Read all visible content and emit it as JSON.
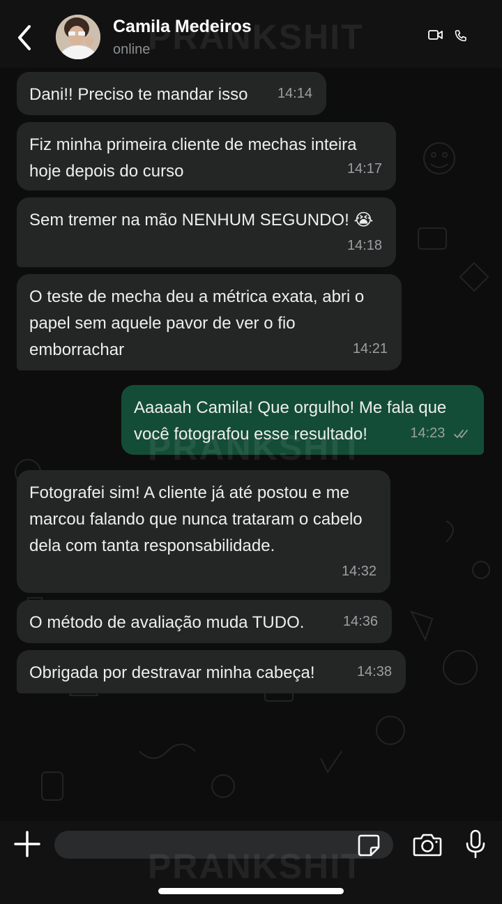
{
  "header": {
    "contact_name": "Camila Medeiros",
    "status": "online",
    "icons": [
      "back-arrow-icon",
      "avatar",
      "video-call-icon",
      "phone-icon"
    ]
  },
  "watermark": "PRANKSHIT",
  "messages": [
    {
      "direction": "incoming",
      "text": "Dani!! Preciso te mandar isso",
      "time": "14:14"
    },
    {
      "direction": "incoming",
      "text": "Fiz minha primeira cliente de mechas inteira hoje depois do curso",
      "time": "14:17"
    },
    {
      "direction": "incoming",
      "text": "Sem tremer na mão NENHUM SEGUNDO! 😭",
      "time": "14:18"
    },
    {
      "direction": "incoming",
      "text": "O teste de mecha deu a métrica exata, abri o papel sem aquele pavor de ver o fio emborrachar",
      "time": "14:21"
    },
    {
      "direction": "outgoing",
      "text": "Aaaaah Camila! Que orgulho! Me fala que você fotografou esse resultado!",
      "time": "14:23",
      "status": "read"
    },
    {
      "direction": "incoming",
      "text": "Fotografei sim! A cliente já até postou e me marcou falando que nunca trataram o cabelo dela com tanta responsabilidade.",
      "time": "14:32"
    },
    {
      "direction": "incoming",
      "text": "O método de avaliação muda TUDO.",
      "time": "14:36"
    },
    {
      "direction": "incoming",
      "text": "Obrigada por destravar minha cabeça!",
      "time": "14:38"
    }
  ],
  "composer": {
    "placeholder": "",
    "icons": [
      "plus-icon",
      "sticker-icon",
      "camera-icon",
      "microphone-icon"
    ]
  },
  "colors": {
    "incoming_bubble": "#242626",
    "outgoing_bubble": "#144d37",
    "background": "#0d0d0d",
    "header": "#121212"
  }
}
